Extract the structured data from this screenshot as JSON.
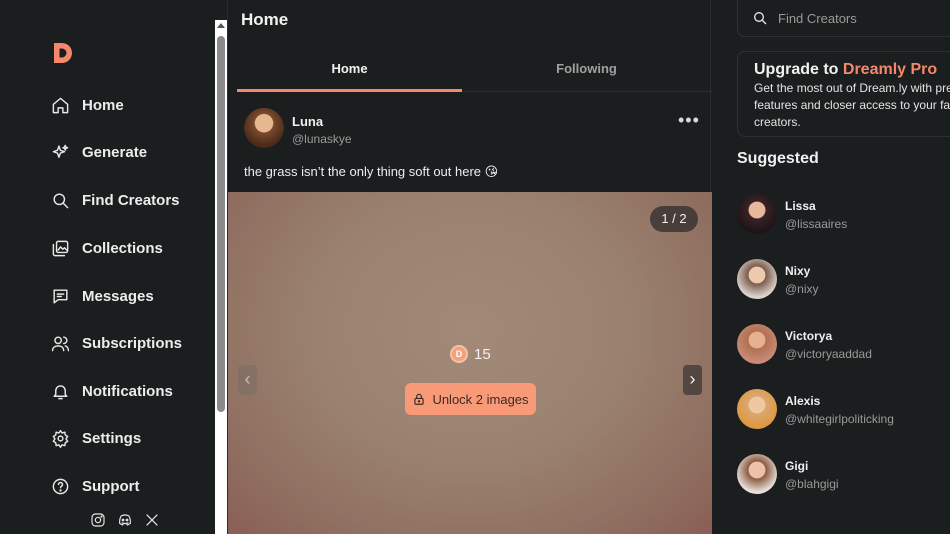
{
  "sidebar": {
    "logo": "dreamly-logo",
    "items": [
      {
        "label": "Home",
        "icon": "home-icon"
      },
      {
        "label": "Generate",
        "icon": "sparkles-icon"
      },
      {
        "label": "Find Creators",
        "icon": "search-icon"
      },
      {
        "label": "Collections",
        "icon": "collection-icon"
      },
      {
        "label": "Messages",
        "icon": "message-icon"
      },
      {
        "label": "Subscriptions",
        "icon": "users-icon"
      },
      {
        "label": "Notifications",
        "icon": "bell-icon"
      },
      {
        "label": "Settings",
        "icon": "gear-icon"
      },
      {
        "label": "Support",
        "icon": "help-icon"
      }
    ],
    "socials": [
      "instagram-icon",
      "discord-icon",
      "x-icon"
    ]
  },
  "main": {
    "title": "Home",
    "tabs": [
      {
        "label": "Home",
        "active": true
      },
      {
        "label": "Following",
        "active": false
      }
    ],
    "post": {
      "name": "Luna",
      "handle": "@lunaskye",
      "caption": "the grass isn’t the only thing soft out here 😘",
      "counter": "1 / 2",
      "price": "15",
      "coin_letter": "D",
      "unlock_label": "Unlock 2 images"
    }
  },
  "right": {
    "search": {
      "placeholder": "Find Creators"
    },
    "promo": {
      "title_prefix": "Upgrade to ",
      "title_accent": "Dreamly Pro",
      "body": "Get the most out of Dream.ly with premium features and closer access to your favorite creators."
    },
    "suggested_title": "Suggested",
    "suggested": [
      {
        "name": "Lissa",
        "handle": "@lissaaires"
      },
      {
        "name": "Nixy",
        "handle": "@nixy"
      },
      {
        "name": "Victorya",
        "handle": "@victoryaaddad"
      },
      {
        "name": "Alexis",
        "handle": "@whitegirlpoliticking"
      },
      {
        "name": "Gigi",
        "handle": "@blahgigi"
      }
    ]
  },
  "colors": {
    "accent": "#f5876a",
    "background": "#1b1e1e",
    "button": "#f89a78"
  }
}
